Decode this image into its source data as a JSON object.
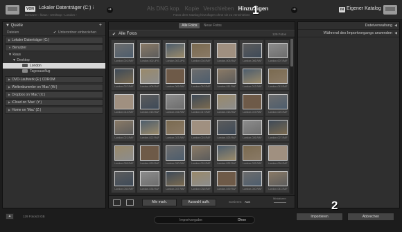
{
  "header": {
    "source_badge": "VON",
    "source_title": "Lokaler Datenträger (C:) ⁝",
    "source_path": "Benutzer › klaus › Desktop › London ›",
    "modes": [
      "Als DNG kop.",
      "Kopie",
      "Verschieben",
      "Hinzufügen"
    ],
    "active_mode": "Hinzufügen",
    "mode_subtitle": "Fotos dem Katalog hinzufügen ohne sie zu verschieben",
    "annotation_1": "1",
    "dest_badge": "IN",
    "dest_title": "Eigener Katalog"
  },
  "left_panel": {
    "title": "Quelle",
    "plus": "+",
    "sub_label": "Dateien",
    "subfolder_label": "Unterordner einbeziehen",
    "volumes": [
      "Lokaler Datenträger (C:)",
      "Benutzer",
      "OVD-Laufwerk (E:) CDROM",
      "Weltenbummler on 'Mac' (W:)",
      "Dropbox on 'Mac' (X:)",
      "iCloud on 'Mac' (Y:)",
      "Home on 'Mac' (Z:)"
    ],
    "tree": {
      "klaus": "klaus",
      "desktop": "Desktop",
      "london": "London",
      "tagesausflug": "Tagesausflug"
    }
  },
  "center": {
    "tabs": [
      "Alle Fotos",
      "Neue Fotos"
    ],
    "active_tab": "Alle Fotos",
    "filter_label": "Alle Fotos",
    "filter_count": "129 Fotos",
    "thumbnails": [
      "London-001.RAF",
      "London-002.JPG",
      "London-003.JPG",
      "London-004.RAF",
      "London-005.RAF",
      "London-006.RAF",
      "London-007.RAF",
      "London-007.RAF",
      "London-008.RAF",
      "London-009.RAF",
      "London-010.RAF",
      "London-011.RAF",
      "London-012.RAF",
      "London-013.RAF",
      "London-014.RAF",
      "London-015.RAF",
      "London-016.RAF",
      "London-017.RAF",
      "London-018.RAF",
      "London-019.RAF",
      "London-020.RAF",
      "London-021.RAF",
      "London-022.RAF",
      "London-023.RAF",
      "London-024.RAF",
      "London-025.RAF",
      "London-026.RAF",
      "London-027.RAF",
      "London-028.RAF",
      "London-029.RAF",
      "London-030.RAF",
      "London-031.RAF",
      "London-032.RAF",
      "London-033.RAF",
      "London-034.RAF",
      "London-035.RAF",
      "London-036.RAF",
      "London-037.RAF",
      "London-038.RAF",
      "London-039.RAF",
      "London-040.RAF",
      "London-041.RAF"
    ],
    "check_all": "Alle mark.",
    "uncheck_all": "Auswahl aufh.",
    "sort_label": "Sortieren:",
    "sort_value": "Aus",
    "thumb_label": "Miniaturen"
  },
  "right_panel": {
    "sections": [
      "Dateiverwaltung",
      "Während des Importvorgangs anwenden"
    ]
  },
  "bottom": {
    "expand": "▲",
    "photo_count": "129 Fotos/3 GB",
    "preset_label": "Importvorgabe:",
    "preset_value": "Ohne",
    "import": "Importieren",
    "cancel": "Abbrechen",
    "annotation_2": "2"
  },
  "colors": {
    "background": "#1c1c1c",
    "panel": "#2f2f2f",
    "accent_text": "#e6e6e6"
  }
}
